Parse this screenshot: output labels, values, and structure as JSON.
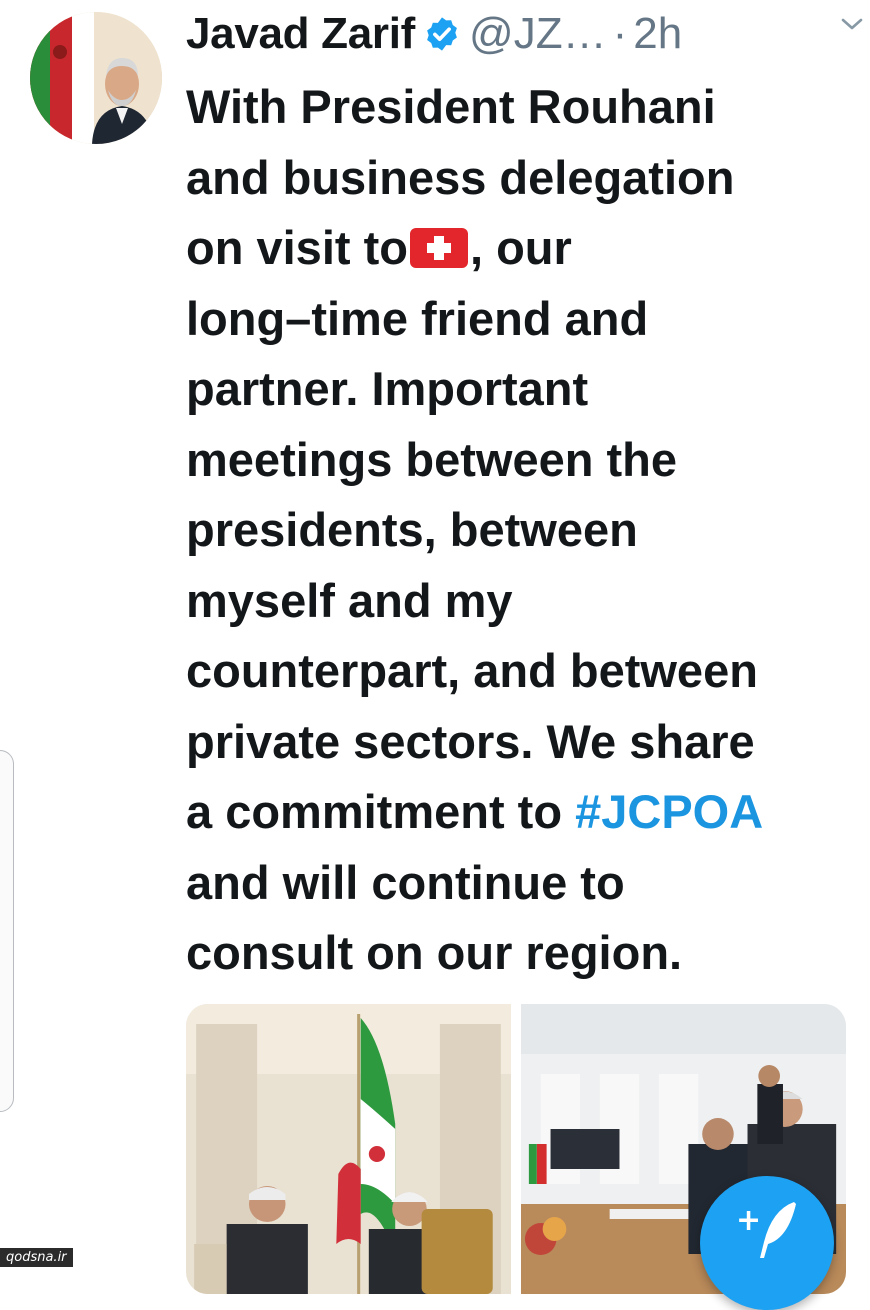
{
  "tweet": {
    "author_name": "Javad Zarif",
    "handle": "@JZ…",
    "separator": "·",
    "timestamp": "2h",
    "text_lines": [
      {
        "before": "With President Rouhani"
      },
      {
        "before": "and business delegation"
      },
      {
        "before": "on visit to",
        "flag": "swiss-flag-emoji",
        "after": ", our"
      },
      {
        "before": "long–time friend and"
      },
      {
        "before": "partner. Important"
      },
      {
        "before": "meetings between the"
      },
      {
        "before": "presidents, between"
      },
      {
        "before": "myself and my"
      },
      {
        "before": "counterpart, and between"
      },
      {
        "before": "private sectors. We share"
      },
      {
        "before": "a commitment to ",
        "hashtag": "#JCPOA"
      },
      {
        "before": "and will continue to"
      },
      {
        "before": "consult on our region."
      }
    ],
    "media": [
      "photo-meeting-flag",
      "photo-meeting-table"
    ]
  },
  "compose_fab": {
    "icon": "feather-plus-icon",
    "plus": "+"
  },
  "watermark": "qodsna.ir",
  "colors": {
    "text": "#14171a",
    "secondary": "#657786",
    "link": "#1b95e0",
    "accent": "#1da1f2"
  }
}
